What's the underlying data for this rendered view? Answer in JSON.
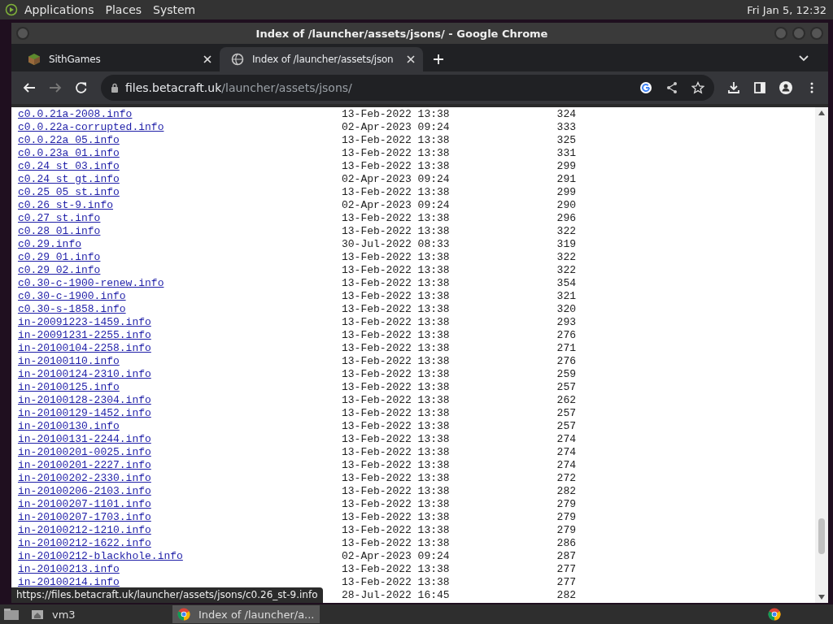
{
  "panel": {
    "menus": [
      "Applications",
      "Places",
      "System"
    ],
    "clock": "Fri Jan  5, 12:32"
  },
  "window": {
    "title": "Index of /launcher/assets/jsons/ - Google Chrome"
  },
  "tabs": [
    {
      "label": "SithGames",
      "selected": false,
      "kind": "site"
    },
    {
      "label": "Index of /launcher/assets/json",
      "selected": true,
      "kind": "globe"
    }
  ],
  "address": {
    "host": "files.betacraft.uk",
    "path": "/launcher/assets/jsons/"
  },
  "listing": [
    {
      "name": "c0.0.21a-2008.info",
      "date": "13-Feb-2022 13:38",
      "size": "324"
    },
    {
      "name": "c0.0.22a-corrupted.info",
      "date": "02-Apr-2023 09:24",
      "size": "333"
    },
    {
      "name": "c0.0.22a_05.info",
      "date": "13-Feb-2022 13:38",
      "size": "325"
    },
    {
      "name": "c0.0.23a_01.info",
      "date": "13-Feb-2022 13:38",
      "size": "331"
    },
    {
      "name": "c0.24_st_03.info",
      "date": "13-Feb-2022 13:38",
      "size": "299"
    },
    {
      "name": "c0.24_st_gt.info",
      "date": "02-Apr-2023 09:24",
      "size": "291"
    },
    {
      "name": "c0.25_05_st.info",
      "date": "13-Feb-2022 13:38",
      "size": "299"
    },
    {
      "name": "c0.26_st-9.info",
      "date": "02-Apr-2023 09:24",
      "size": "290"
    },
    {
      "name": "c0.27_st.info",
      "date": "13-Feb-2022 13:38",
      "size": "296"
    },
    {
      "name": "c0.28_01.info",
      "date": "13-Feb-2022 13:38",
      "size": "322"
    },
    {
      "name": "c0.29.info",
      "date": "30-Jul-2022 08:33",
      "size": "319"
    },
    {
      "name": "c0.29_01.info",
      "date": "13-Feb-2022 13:38",
      "size": "322"
    },
    {
      "name": "c0.29_02.info",
      "date": "13-Feb-2022 13:38",
      "size": "322"
    },
    {
      "name": "c0.30-c-1900-renew.info",
      "date": "13-Feb-2022 13:38",
      "size": "354"
    },
    {
      "name": "c0.30-c-1900.info",
      "date": "13-Feb-2022 13:38",
      "size": "321"
    },
    {
      "name": "c0.30-s-1858.info",
      "date": "13-Feb-2022 13:38",
      "size": "320"
    },
    {
      "name": "in-20091223-1459.info",
      "date": "13-Feb-2022 13:38",
      "size": "293"
    },
    {
      "name": "in-20091231-2255.info",
      "date": "13-Feb-2022 13:38",
      "size": "276"
    },
    {
      "name": "in-20100104-2258.info",
      "date": "13-Feb-2022 13:38",
      "size": "271"
    },
    {
      "name": "in-20100110.info",
      "date": "13-Feb-2022 13:38",
      "size": "276"
    },
    {
      "name": "in-20100124-2310.info",
      "date": "13-Feb-2022 13:38",
      "size": "259"
    },
    {
      "name": "in-20100125.info",
      "date": "13-Feb-2022 13:38",
      "size": "257"
    },
    {
      "name": "in-20100128-2304.info",
      "date": "13-Feb-2022 13:38",
      "size": "262"
    },
    {
      "name": "in-20100129-1452.info",
      "date": "13-Feb-2022 13:38",
      "size": "257"
    },
    {
      "name": "in-20100130.info",
      "date": "13-Feb-2022 13:38",
      "size": "257"
    },
    {
      "name": "in-20100131-2244.info",
      "date": "13-Feb-2022 13:38",
      "size": "274"
    },
    {
      "name": "in-20100201-0025.info",
      "date": "13-Feb-2022 13:38",
      "size": "274"
    },
    {
      "name": "in-20100201-2227.info",
      "date": "13-Feb-2022 13:38",
      "size": "274"
    },
    {
      "name": "in-20100202-2330.info",
      "date": "13-Feb-2022 13:38",
      "size": "272"
    },
    {
      "name": "in-20100206-2103.info",
      "date": "13-Feb-2022 13:38",
      "size": "282"
    },
    {
      "name": "in-20100207-1101.info",
      "date": "13-Feb-2022 13:38",
      "size": "279"
    },
    {
      "name": "in-20100207-1703.info",
      "date": "13-Feb-2022 13:38",
      "size": "279"
    },
    {
      "name": "in-20100212-1210.info",
      "date": "13-Feb-2022 13:38",
      "size": "279"
    },
    {
      "name": "in-20100212-1622.info",
      "date": "13-Feb-2022 13:38",
      "size": "286"
    },
    {
      "name": "in-20100212-blackhole.info",
      "date": "02-Apr-2023 09:24",
      "size": "287"
    },
    {
      "name": "in-20100213.info",
      "date": "13-Feb-2022 13:38",
      "size": "277"
    },
    {
      "name": "in-20100214.info",
      "date": "13-Feb-2022 13:38",
      "size": "277"
    },
    {
      "date": "28-Jul-2022 16:45",
      "size": "282"
    }
  ],
  "status_url": "https://files.betacraft.uk/launcher/assets/jsons/c0.26_st-9.info",
  "taskbar": [
    {
      "label": "vm3",
      "kind": "folder"
    },
    {
      "label": "Index of /launcher/a...",
      "kind": "browser"
    }
  ]
}
